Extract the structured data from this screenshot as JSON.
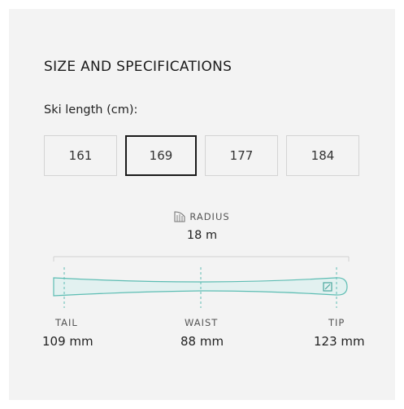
{
  "section": {
    "title": "SIZE AND SPECIFICATIONS"
  },
  "ski_length": {
    "label": "Ski length (cm):",
    "options": [
      "161",
      "169",
      "177",
      "184"
    ],
    "selected": "169"
  },
  "radius": {
    "label": "RADIUS",
    "value": "18 m",
    "icon": "radius-icon"
  },
  "dimensions": {
    "tail": {
      "label": "TAIL",
      "value": "109 mm"
    },
    "waist": {
      "label": "WAIST",
      "value": "88 mm"
    },
    "tip": {
      "label": "TIP",
      "value": "123 mm"
    }
  },
  "colors": {
    "ski_fill": "#e2f1f0",
    "ski_outline": "#5dbdb3",
    "selected_border": "#1a1a1a"
  }
}
